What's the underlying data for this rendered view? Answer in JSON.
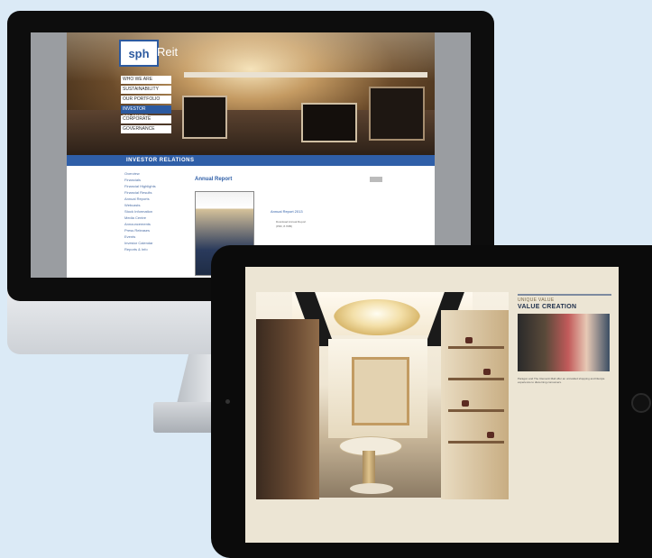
{
  "desktop_site": {
    "logo_mark": "sph",
    "logo_text": "Reit",
    "menu": [
      "WHO WE ARE",
      "SUSTAINABILITY",
      "OUR PORTFOLIO",
      "INVESTOR RELATIONS",
      "CORPORATE",
      "GOVERNANCE"
    ],
    "menu_active_index": 3,
    "section_bar": "INVESTOR RELATIONS",
    "sidebar_items": [
      "Overview",
      "Financials",
      "Financial Highlights",
      "Financial Results",
      "Annual Reports",
      "Webcasts",
      "Stock Information",
      "Media Centre",
      "Announcements",
      "Press Releases",
      "Events",
      "Investor Calendar",
      "Reports & Info"
    ],
    "content_heading": "Annual Report",
    "report_link": "Annual Report 2013",
    "report_list": [
      "Download Annual Report",
      "(PDF, 8.7MB)"
    ]
  },
  "tablet_page": {
    "caption_kicker": "UNIQUE VALUE",
    "caption_title": "VALUE CREATION",
    "caption_body": "Paragon and The Clementi Mall offer an unrivalled shopping and lifestyle experience to discerning consumers."
  }
}
